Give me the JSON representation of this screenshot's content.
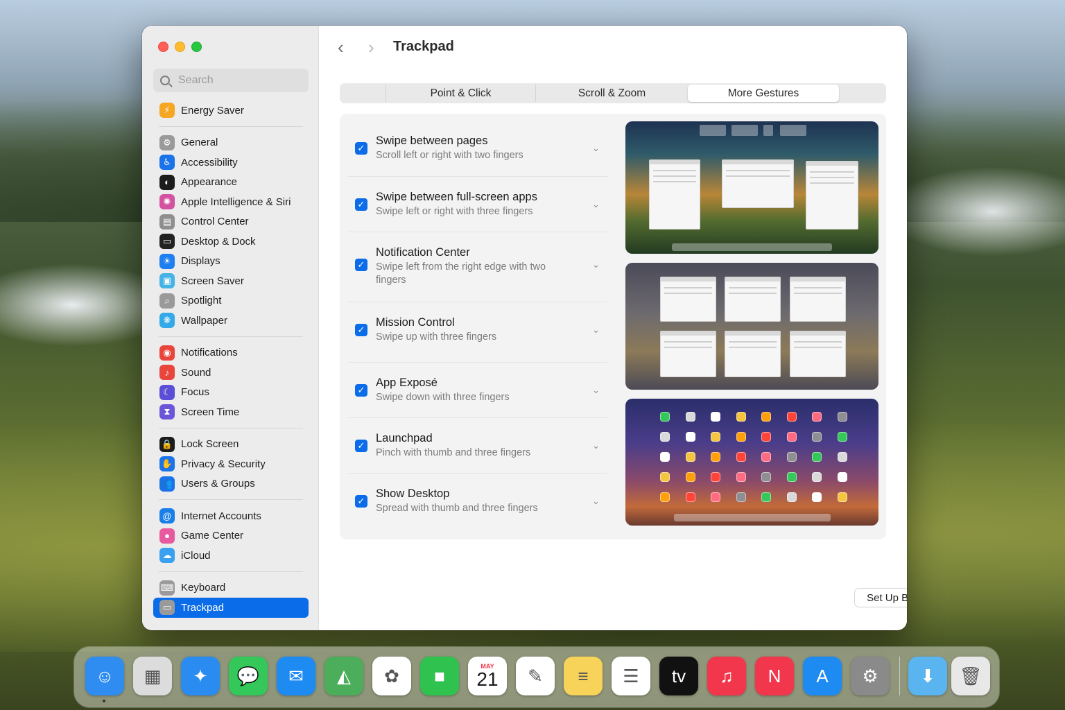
{
  "window": {
    "title": "Trackpad",
    "nav_back": "‹",
    "nav_forward": "›"
  },
  "search": {
    "placeholder": "Search"
  },
  "sidebar": {
    "groups": [
      [
        {
          "label": "Energy Saver",
          "icon": "bolt-icon",
          "color": "#f5a623",
          "glyph": "⚡"
        }
      ],
      [
        {
          "label": "General",
          "icon": "gear-icon",
          "color": "#9a9a9a",
          "glyph": "⚙"
        },
        {
          "label": "Accessibility",
          "icon": "accessibility-icon",
          "color": "#1a73e8",
          "glyph": "♿"
        },
        {
          "label": "Appearance",
          "icon": "appearance-icon",
          "color": "#1c1c1c",
          "glyph": "◐"
        },
        {
          "label": "Apple Intelligence & Siri",
          "icon": "siri-icon",
          "color": "#d452a0",
          "glyph": "✺"
        },
        {
          "label": "Control Center",
          "icon": "control-center-icon",
          "color": "#8e8e8e",
          "glyph": "▤"
        },
        {
          "label": "Desktop & Dock",
          "icon": "desktop-dock-icon",
          "color": "#222222",
          "glyph": "▭"
        },
        {
          "label": "Displays",
          "icon": "displays-icon",
          "color": "#1e7ff0",
          "glyph": "☀"
        },
        {
          "label": "Screen Saver",
          "icon": "screen-saver-icon",
          "color": "#46b3e6",
          "glyph": "▣"
        },
        {
          "label": "Spotlight",
          "icon": "spotlight-icon",
          "color": "#9a9a9a",
          "glyph": "⌕"
        },
        {
          "label": "Wallpaper",
          "icon": "wallpaper-icon",
          "color": "#33a9e8",
          "glyph": "❋"
        }
      ],
      [
        {
          "label": "Notifications",
          "icon": "notifications-icon",
          "color": "#e8463c",
          "glyph": "◉"
        },
        {
          "label": "Sound",
          "icon": "sound-icon",
          "color": "#e8463c",
          "glyph": "♪"
        },
        {
          "label": "Focus",
          "icon": "focus-icon",
          "color": "#5b4fd6",
          "glyph": "☾"
        },
        {
          "label": "Screen Time",
          "icon": "screen-time-icon",
          "color": "#6a57d8",
          "glyph": "⧗"
        }
      ],
      [
        {
          "label": "Lock Screen",
          "icon": "lock-icon",
          "color": "#1c1c1c",
          "glyph": "🔒"
        },
        {
          "label": "Privacy & Security",
          "icon": "hand-icon",
          "color": "#1a73e8",
          "glyph": "✋"
        },
        {
          "label": "Users & Groups",
          "icon": "users-icon",
          "color": "#1a73e8",
          "glyph": "👥"
        }
      ],
      [
        {
          "label": "Internet Accounts",
          "icon": "at-icon",
          "color": "#1a7fe8",
          "glyph": "@"
        },
        {
          "label": "Game Center",
          "icon": "game-center-icon",
          "color": "#e85aa0",
          "glyph": "●"
        },
        {
          "label": "iCloud",
          "icon": "cloud-icon",
          "color": "#3aa0f0",
          "glyph": "☁"
        }
      ],
      [
        {
          "label": "Keyboard",
          "icon": "keyboard-icon",
          "color": "#9a9a9a",
          "glyph": "⌨"
        },
        {
          "label": "Trackpad",
          "icon": "trackpad-icon",
          "color": "#9a9a9a",
          "glyph": "▭",
          "selected": true
        }
      ]
    ]
  },
  "tabs": [
    "Point & Click",
    "Scroll & Zoom",
    "More Gestures"
  ],
  "gestures": [
    {
      "title": "Swipe between pages",
      "subtitle": "Scroll left or right with two fingers"
    },
    {
      "title": "Swipe between full-screen apps",
      "subtitle": "Swipe left or right with three fingers"
    },
    {
      "title": "Notification Center",
      "subtitle": "Swipe left from the right edge with two fingers"
    },
    {
      "title": "Mission Control",
      "subtitle": "Swipe up with three fingers"
    },
    {
      "title": "App Exposé",
      "subtitle": "Swipe down with three fingers"
    },
    {
      "title": "Launchpad",
      "subtitle": "Pinch with thumb and three fingers"
    },
    {
      "title": "Show Desktop",
      "subtitle": "Spread with thumb and three fingers"
    }
  ],
  "buttons": {
    "bluetooth": "Set Up Bluetooth Trackpad...",
    "help": "?"
  },
  "dock": [
    {
      "name": "Finder",
      "icon": "finder-icon",
      "color": "#2f8cf0",
      "glyph": "☺"
    },
    {
      "name": "Launchpad",
      "icon": "launchpad-icon",
      "color": "#dcdcdc",
      "glyph": "▦"
    },
    {
      "name": "Safari",
      "icon": "safari-icon",
      "color": "#2a8cf0",
      "glyph": "✦"
    },
    {
      "name": "Messages",
      "icon": "messages-icon",
      "color": "#34c759",
      "glyph": "💬"
    },
    {
      "name": "Mail",
      "icon": "mail-icon",
      "color": "#1e8bf2",
      "glyph": "✉"
    },
    {
      "name": "Maps",
      "icon": "maps-icon",
      "color": "#4cae5a",
      "glyph": "◭"
    },
    {
      "name": "Photos",
      "icon": "photos-icon",
      "color": "#ffffff",
      "glyph": "✿"
    },
    {
      "name": "FaceTime",
      "icon": "facetime-icon",
      "color": "#30c24e",
      "glyph": "■"
    },
    {
      "name": "Calendar",
      "icon": "calendar-icon",
      "color": "#ffffff",
      "month": "MAY",
      "day": "21"
    },
    {
      "name": "Freeform",
      "icon": "freeform-icon",
      "color": "#ffffff",
      "glyph": "✎"
    },
    {
      "name": "Notes",
      "icon": "notes-icon",
      "color": "#f7d35a",
      "glyph": "≡"
    },
    {
      "name": "Reminders",
      "icon": "reminders-icon",
      "color": "#ffffff",
      "glyph": "☰"
    },
    {
      "name": "TV",
      "icon": "tv-icon",
      "color": "#111111",
      "glyph": "tv"
    },
    {
      "name": "Music",
      "icon": "music-icon",
      "color": "#f2364b",
      "glyph": "♫"
    },
    {
      "name": "News",
      "icon": "news-icon",
      "color": "#f2364b",
      "glyph": "N"
    },
    {
      "name": "App Store",
      "icon": "app-store-icon",
      "color": "#1e8bf2",
      "glyph": "A"
    },
    {
      "name": "System Settings",
      "icon": "system-settings-icon",
      "color": "#8a8a8a",
      "glyph": "⚙"
    },
    {
      "name": "Downloads",
      "icon": "folder-icon",
      "color": "#5ab4f0",
      "glyph": "⬇"
    },
    {
      "name": "Trash",
      "icon": "trash-icon",
      "color": "#e8e8e8",
      "glyph": "🗑"
    }
  ]
}
